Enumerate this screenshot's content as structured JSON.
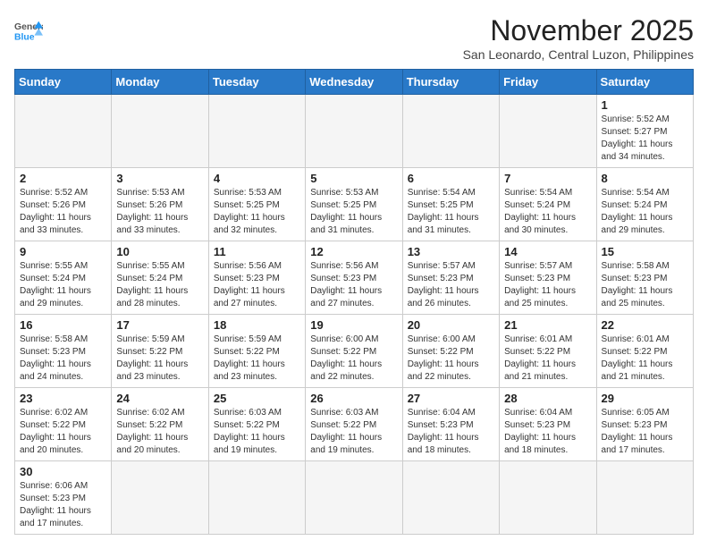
{
  "header": {
    "logo_general": "General",
    "logo_blue": "Blue",
    "month": "November 2025",
    "location": "San Leonardo, Central Luzon, Philippines"
  },
  "weekdays": [
    "Sunday",
    "Monday",
    "Tuesday",
    "Wednesday",
    "Thursday",
    "Friday",
    "Saturday"
  ],
  "weeks": [
    [
      {
        "day": "",
        "info": ""
      },
      {
        "day": "",
        "info": ""
      },
      {
        "day": "",
        "info": ""
      },
      {
        "day": "",
        "info": ""
      },
      {
        "day": "",
        "info": ""
      },
      {
        "day": "",
        "info": ""
      },
      {
        "day": "1",
        "info": "Sunrise: 5:52 AM\nSunset: 5:27 PM\nDaylight: 11 hours and 34 minutes."
      }
    ],
    [
      {
        "day": "2",
        "info": "Sunrise: 5:52 AM\nSunset: 5:26 PM\nDaylight: 11 hours and 33 minutes."
      },
      {
        "day": "3",
        "info": "Sunrise: 5:53 AM\nSunset: 5:26 PM\nDaylight: 11 hours and 33 minutes."
      },
      {
        "day": "4",
        "info": "Sunrise: 5:53 AM\nSunset: 5:25 PM\nDaylight: 11 hours and 32 minutes."
      },
      {
        "day": "5",
        "info": "Sunrise: 5:53 AM\nSunset: 5:25 PM\nDaylight: 11 hours and 31 minutes."
      },
      {
        "day": "6",
        "info": "Sunrise: 5:54 AM\nSunset: 5:25 PM\nDaylight: 11 hours and 31 minutes."
      },
      {
        "day": "7",
        "info": "Sunrise: 5:54 AM\nSunset: 5:24 PM\nDaylight: 11 hours and 30 minutes."
      },
      {
        "day": "8",
        "info": "Sunrise: 5:54 AM\nSunset: 5:24 PM\nDaylight: 11 hours and 29 minutes."
      }
    ],
    [
      {
        "day": "9",
        "info": "Sunrise: 5:55 AM\nSunset: 5:24 PM\nDaylight: 11 hours and 29 minutes."
      },
      {
        "day": "10",
        "info": "Sunrise: 5:55 AM\nSunset: 5:24 PM\nDaylight: 11 hours and 28 minutes."
      },
      {
        "day": "11",
        "info": "Sunrise: 5:56 AM\nSunset: 5:23 PM\nDaylight: 11 hours and 27 minutes."
      },
      {
        "day": "12",
        "info": "Sunrise: 5:56 AM\nSunset: 5:23 PM\nDaylight: 11 hours and 27 minutes."
      },
      {
        "day": "13",
        "info": "Sunrise: 5:57 AM\nSunset: 5:23 PM\nDaylight: 11 hours and 26 minutes."
      },
      {
        "day": "14",
        "info": "Sunrise: 5:57 AM\nSunset: 5:23 PM\nDaylight: 11 hours and 25 minutes."
      },
      {
        "day": "15",
        "info": "Sunrise: 5:58 AM\nSunset: 5:23 PM\nDaylight: 11 hours and 25 minutes."
      }
    ],
    [
      {
        "day": "16",
        "info": "Sunrise: 5:58 AM\nSunset: 5:23 PM\nDaylight: 11 hours and 24 minutes."
      },
      {
        "day": "17",
        "info": "Sunrise: 5:59 AM\nSunset: 5:22 PM\nDaylight: 11 hours and 23 minutes."
      },
      {
        "day": "18",
        "info": "Sunrise: 5:59 AM\nSunset: 5:22 PM\nDaylight: 11 hours and 23 minutes."
      },
      {
        "day": "19",
        "info": "Sunrise: 6:00 AM\nSunset: 5:22 PM\nDaylight: 11 hours and 22 minutes."
      },
      {
        "day": "20",
        "info": "Sunrise: 6:00 AM\nSunset: 5:22 PM\nDaylight: 11 hours and 22 minutes."
      },
      {
        "day": "21",
        "info": "Sunrise: 6:01 AM\nSunset: 5:22 PM\nDaylight: 11 hours and 21 minutes."
      },
      {
        "day": "22",
        "info": "Sunrise: 6:01 AM\nSunset: 5:22 PM\nDaylight: 11 hours and 21 minutes."
      }
    ],
    [
      {
        "day": "23",
        "info": "Sunrise: 6:02 AM\nSunset: 5:22 PM\nDaylight: 11 hours and 20 minutes."
      },
      {
        "day": "24",
        "info": "Sunrise: 6:02 AM\nSunset: 5:22 PM\nDaylight: 11 hours and 20 minutes."
      },
      {
        "day": "25",
        "info": "Sunrise: 6:03 AM\nSunset: 5:22 PM\nDaylight: 11 hours and 19 minutes."
      },
      {
        "day": "26",
        "info": "Sunrise: 6:03 AM\nSunset: 5:22 PM\nDaylight: 11 hours and 19 minutes."
      },
      {
        "day": "27",
        "info": "Sunrise: 6:04 AM\nSunset: 5:23 PM\nDaylight: 11 hours and 18 minutes."
      },
      {
        "day": "28",
        "info": "Sunrise: 6:04 AM\nSunset: 5:23 PM\nDaylight: 11 hours and 18 minutes."
      },
      {
        "day": "29",
        "info": "Sunrise: 6:05 AM\nSunset: 5:23 PM\nDaylight: 11 hours and 17 minutes."
      }
    ],
    [
      {
        "day": "30",
        "info": "Sunrise: 6:06 AM\nSunset: 5:23 PM\nDaylight: 11 hours and 17 minutes."
      },
      {
        "day": "",
        "info": ""
      },
      {
        "day": "",
        "info": ""
      },
      {
        "day": "",
        "info": ""
      },
      {
        "day": "",
        "info": ""
      },
      {
        "day": "",
        "info": ""
      },
      {
        "day": "",
        "info": ""
      }
    ]
  ]
}
